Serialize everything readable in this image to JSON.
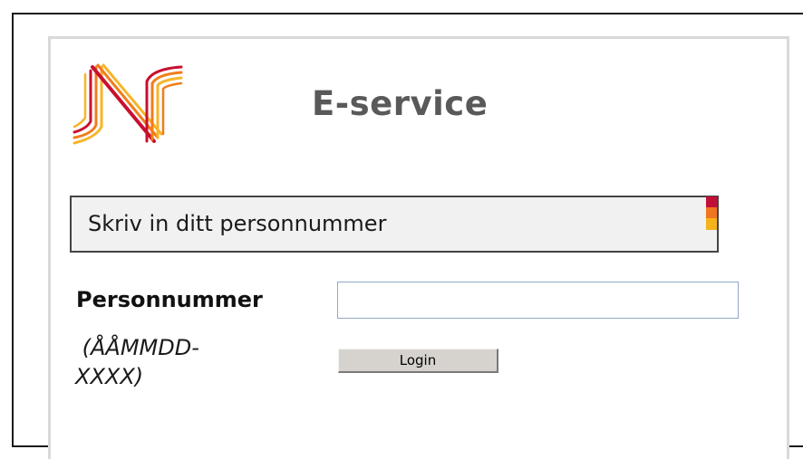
{
  "header": {
    "title": "E-service",
    "logo_icon": "norrland-n-logo-icon"
  },
  "info_box": {
    "text": "Skriv in ditt personnummer",
    "stripe_colors": [
      "#c0103a",
      "#f0751e",
      "#f6b21a"
    ]
  },
  "form": {
    "personnummer_label": "Personnummer",
    "personnummer_value": "",
    "personnummer_placeholder": "",
    "format_hint": " (ÅÅMMDD-\nXXXX)",
    "login_label": "Login"
  },
  "colors": {
    "logo_red": "#c8102e",
    "logo_orange": "#f07d1a",
    "logo_yellow": "#f7b52a",
    "title_gray": "#595959",
    "info_bg": "#f1f1f1"
  }
}
